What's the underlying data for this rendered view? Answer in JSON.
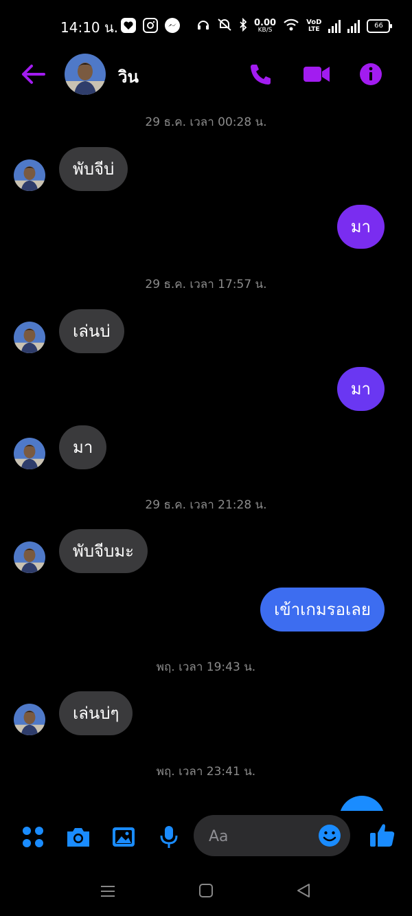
{
  "status": {
    "time": "14:10 น.",
    "net_speed": "0.00",
    "net_unit": "KB/S",
    "vo": "VoD",
    "lte": "LTE",
    "battery": "66"
  },
  "header": {
    "name": "วิน",
    "accent": "#a21cf0"
  },
  "messages": [
    {
      "type": "timestamp",
      "text": "29 ธ.ค. เวลา 00:28 น."
    },
    {
      "type": "in",
      "text": "พับจีบ่"
    },
    {
      "type": "out",
      "text": "มา",
      "color": "#7a2df0"
    },
    {
      "type": "timestamp",
      "text": "29 ธ.ค. เวลา 17:57 น."
    },
    {
      "type": "in",
      "text": "เล่นบ่"
    },
    {
      "type": "out",
      "text": "มา",
      "color": "#6a37f2"
    },
    {
      "type": "in",
      "text": "มา"
    },
    {
      "type": "timestamp",
      "text": "29 ธ.ค. เวลา 21:28 น."
    },
    {
      "type": "in",
      "text": "พับจีบมะ"
    },
    {
      "type": "out",
      "text": "เข้าเกมรอเลย",
      "color": "#3d6df0"
    },
    {
      "type": "timestamp",
      "text": "พฤ. เวลา 19:43 น."
    },
    {
      "type": "in",
      "text": "เล่นบ่ๆ"
    },
    {
      "type": "timestamp",
      "text": "พฤ. เวลา 23:41 น."
    }
  ],
  "composer": {
    "placeholder": "Aa",
    "accent": "#1a8cff"
  }
}
